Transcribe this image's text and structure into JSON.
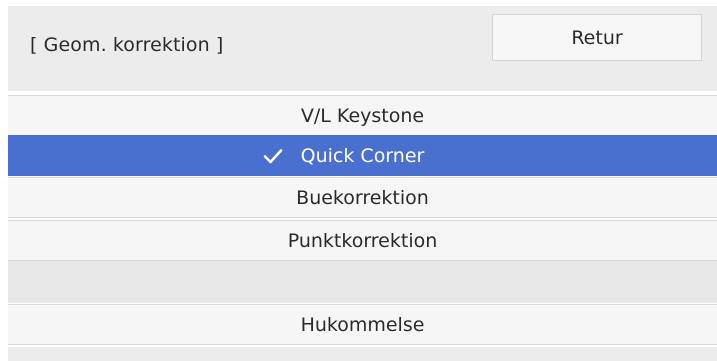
{
  "header": {
    "title": "[ Geom. korrektion ]",
    "back_label": "Retur"
  },
  "menu": {
    "items": [
      {
        "label": "V/L Keystone",
        "selected": false
      },
      {
        "label": "Quick Corner",
        "selected": true
      },
      {
        "label": "Buekorrektion",
        "selected": false
      },
      {
        "label": "Punktkorrektion",
        "selected": false
      }
    ],
    "memory_label": "Hukommelse"
  },
  "colors": {
    "selected_bg": "#4a70cf",
    "header_bg": "#ececec",
    "row_bg": "#f6f6f6"
  },
  "icons": {
    "selected_marker": "check-icon"
  }
}
